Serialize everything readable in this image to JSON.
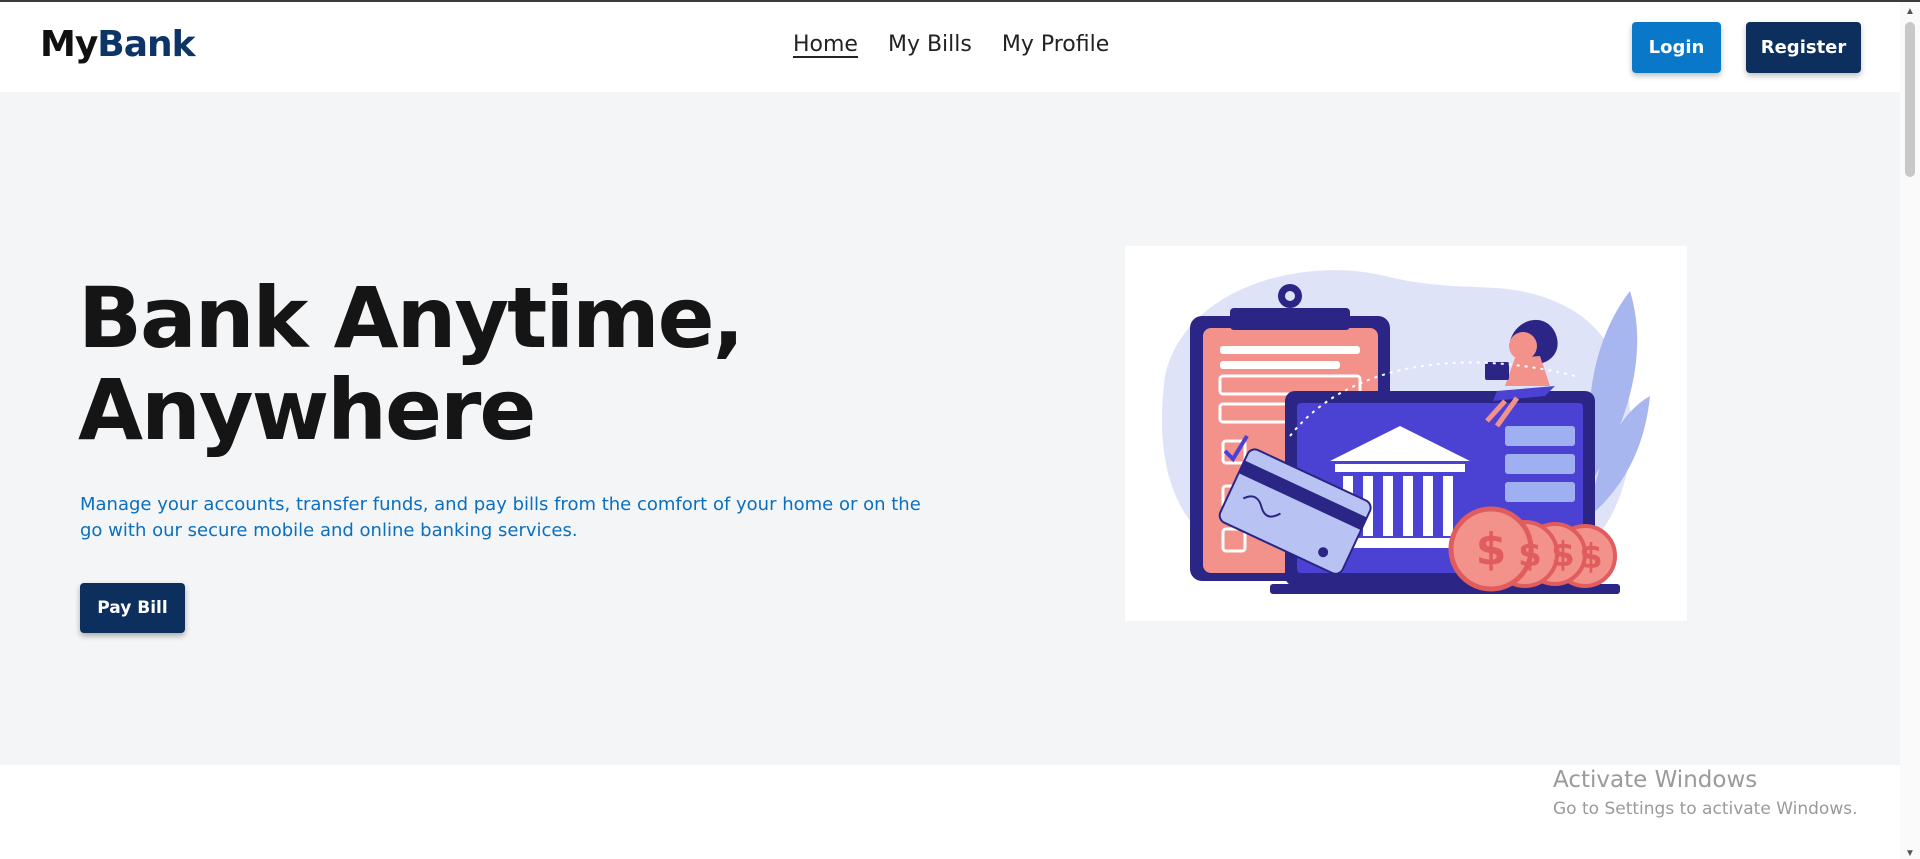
{
  "brand": {
    "part1": "My",
    "part2": "Bank"
  },
  "nav": {
    "items": [
      {
        "label": "Home"
      },
      {
        "label": "My Bills"
      },
      {
        "label": "My Profile"
      }
    ]
  },
  "header": {
    "login_label": "Login",
    "register_label": "Register"
  },
  "hero": {
    "title_line1": "Bank Anytime,",
    "title_line2": "Anywhere",
    "description": "Manage your accounts, transfer funds, and pay bills from the comfort of your home or on the go with our secure mobile and online banking services.",
    "cta_label": "Pay Bill",
    "illustration_icon": "online-banking-illustration"
  },
  "watermark": {
    "title": "Activate Windows",
    "subtitle": "Go to Settings to activate Windows."
  },
  "colors": {
    "brand_dark": "#0d2f5e",
    "accent_blue": "#0a78c8",
    "hero_bg": "#f4f5f7"
  }
}
